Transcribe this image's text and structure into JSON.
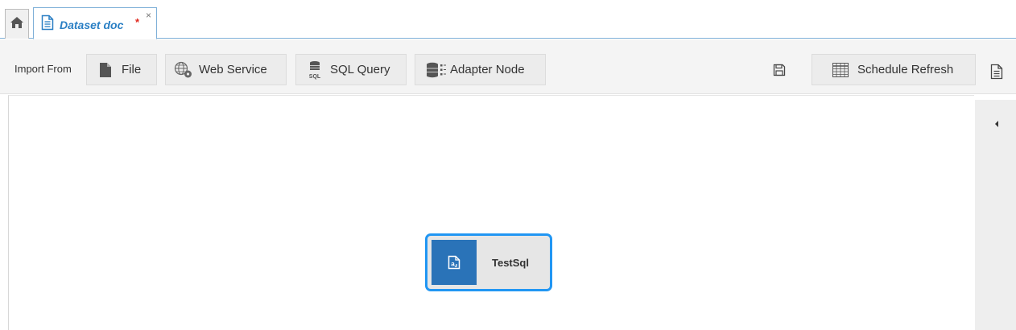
{
  "tabs": {
    "home_icon": "home-icon",
    "active_tab": {
      "title": "Dataset doc",
      "modified_marker": "*",
      "close": "×",
      "icon": "document-icon"
    }
  },
  "toolbar": {
    "import_label": "Import From",
    "buttons": [
      {
        "label": "File",
        "icon": "file-icon"
      },
      {
        "label": "Web Service",
        "icon": "web-service-icon"
      },
      {
        "label": "SQL Query",
        "icon": "sql-database-icon"
      },
      {
        "label": "Adapter Node",
        "icon": "adapter-node-icon"
      }
    ],
    "save_icon": "save-icon",
    "schedule_refresh": {
      "label": "Schedule Refresh",
      "icon": "table-grid-icon"
    },
    "doc_icon": "document-icon"
  },
  "canvas": {
    "node": {
      "label": "TestSql",
      "icon": "sql-node-icon"
    },
    "collapse_icon": "caret-left-icon"
  },
  "colors": {
    "accent": "#2a7fc4",
    "node_border": "#2196f3",
    "node_icon_bg": "#2a73b8",
    "modified_marker": "#e0261b"
  }
}
